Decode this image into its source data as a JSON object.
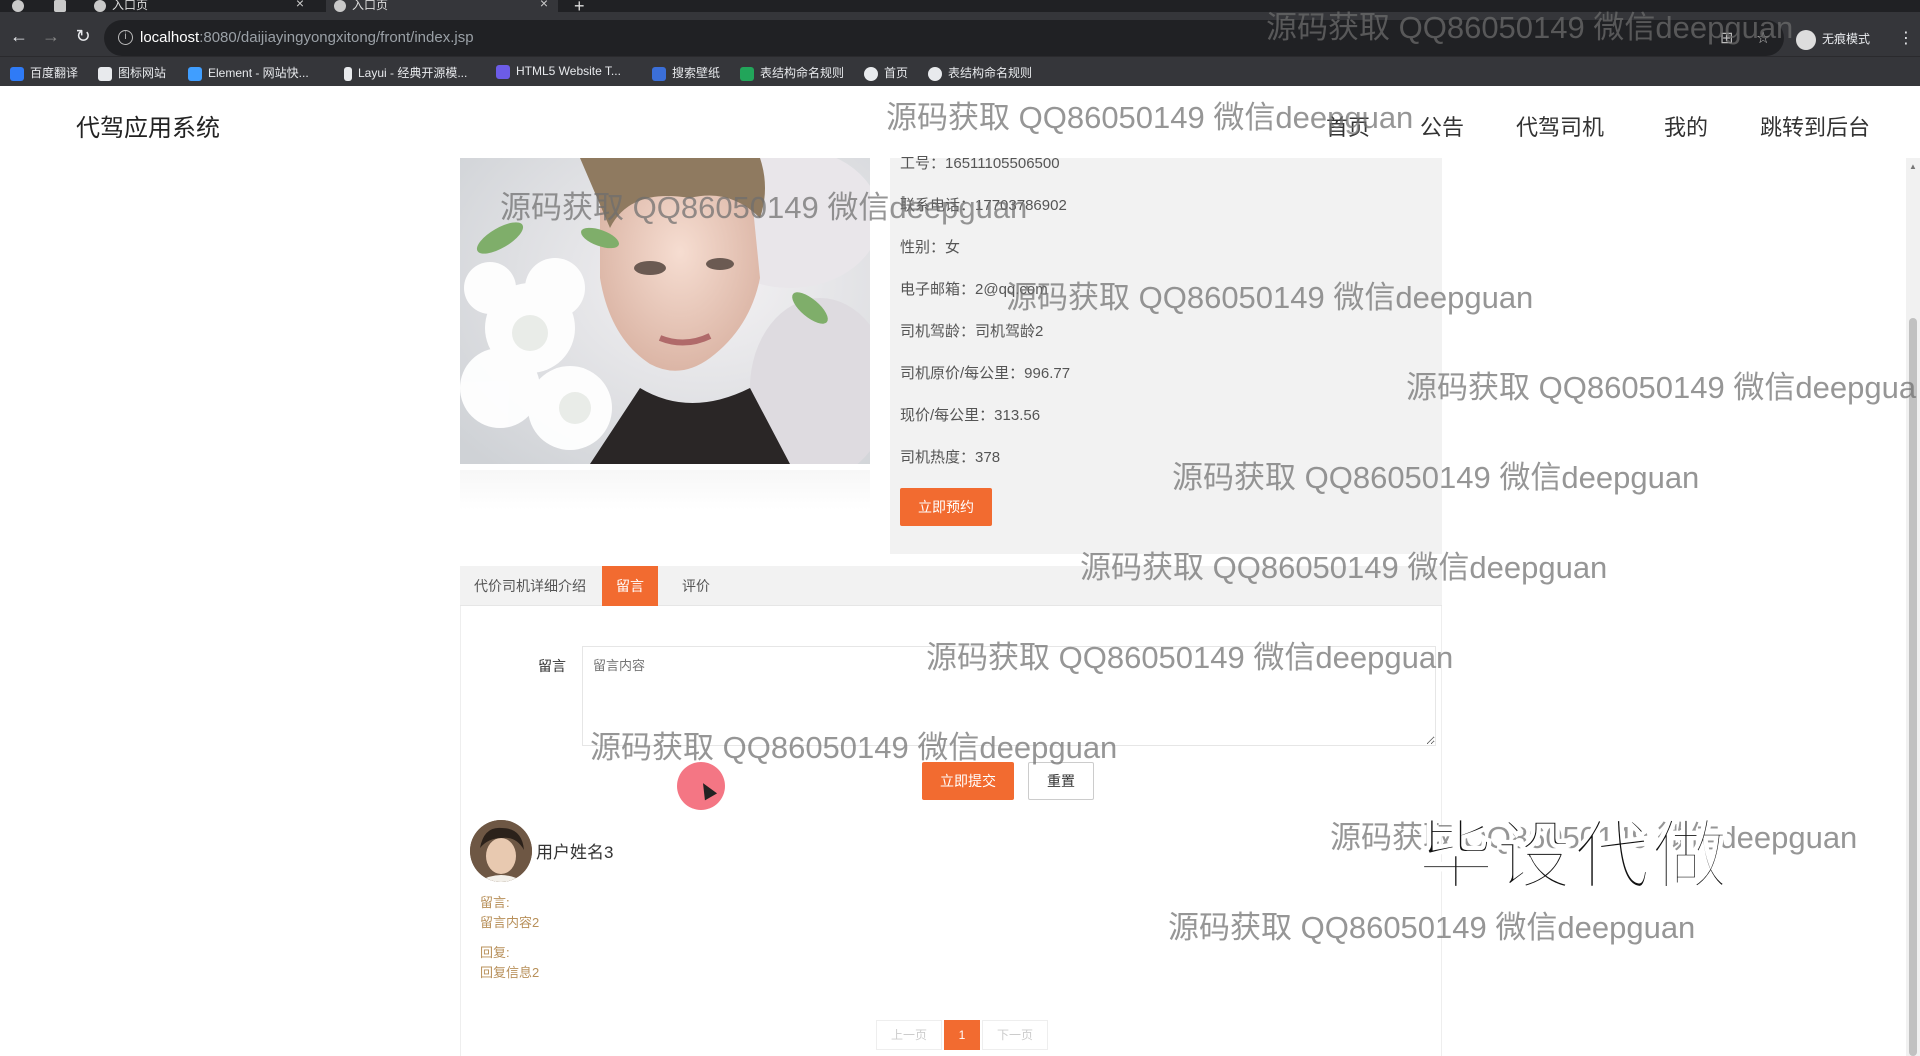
{
  "browser": {
    "tabs": [
      {
        "title": "入口页"
      },
      {
        "title": "入口页"
      }
    ],
    "new_tab_symbol": "+",
    "url_host": "localhost",
    "url_path": ":8080/daijiayingyongxitong/front/index.jsp",
    "incognito_label": "无痕模式",
    "bookmarks": [
      {
        "label": "百度翻译",
        "color": "#2f7bf6"
      },
      {
        "label": "图标网站",
        "color": "#e8eaed"
      },
      {
        "label": "Element - 网站快...",
        "color": "#409eff"
      },
      {
        "label": "Layui - 经典开源模...",
        "color": "#e8eaed"
      },
      {
        "label": "HTML5 Website T...",
        "color": "#6c5ce7"
      },
      {
        "label": "搜索壁纸",
        "color": "#3b6fd8"
      },
      {
        "label": "表结构命名规则",
        "color": "#22a55a"
      },
      {
        "label": "首页",
        "color": "#e8eaed"
      },
      {
        "label": "表结构命名规则",
        "color": "#e8eaed"
      }
    ]
  },
  "site": {
    "logo": "代驾应用系统",
    "nav": [
      "首页",
      "公告",
      "代驾司机",
      "我的",
      "跳转到后台"
    ]
  },
  "driver": {
    "rows": [
      {
        "label": "工号：",
        "value": "16511105506500"
      },
      {
        "label": "联系电话：",
        "value": "17703786902"
      },
      {
        "label": "性别：",
        "value": "女"
      },
      {
        "label": "电子邮箱：",
        "value": "2@qq.com"
      },
      {
        "label": "司机驾龄：",
        "value": "司机驾龄2"
      },
      {
        "label": "司机原价/每公里：",
        "value": "996.77"
      },
      {
        "label": "现价/每公里：",
        "value": "313.56"
      },
      {
        "label": "司机热度：",
        "value": "378"
      }
    ],
    "book_button": "立即预约"
  },
  "tabs": [
    {
      "label": "代价司机详细介绍",
      "active": false
    },
    {
      "label": "留言",
      "active": true
    },
    {
      "label": "评价",
      "active": false
    }
  ],
  "message_form": {
    "label": "留言",
    "placeholder": "留言内容",
    "submit": "立即提交",
    "reset": "重置"
  },
  "comment": {
    "user": "用户姓名3",
    "msg_label": "留言:",
    "msg_text": "留言内容2",
    "reply_label": "回复:",
    "reply_text": "回复信息2"
  },
  "pager": {
    "prev": "上一页",
    "current": "1",
    "next": "下一页"
  },
  "watermark": {
    "text": "源码获取 QQ86050149 微信deepguan",
    "truncated": "源码获取 QQ86050149 微信deepgua",
    "stamp": "毕设代做"
  },
  "colors": {
    "accent": "#f26b30",
    "comment_text": "#b8905a"
  }
}
